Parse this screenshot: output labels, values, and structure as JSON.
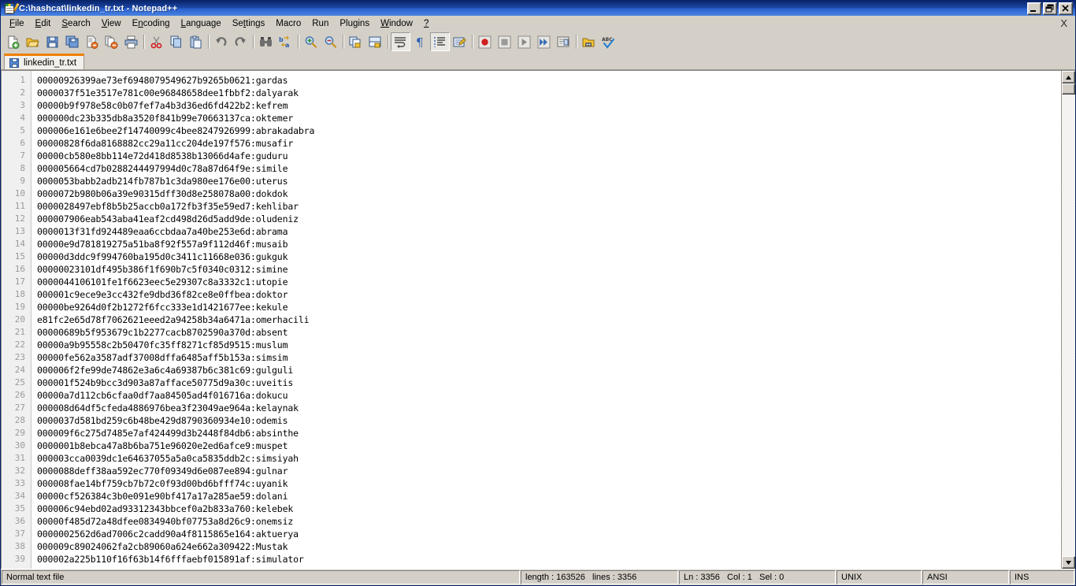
{
  "window": {
    "title": "C:\\hashcat\\linkedin_tr.txt - Notepad++",
    "icon": "notepad-plus-plus-icon",
    "controls": [
      {
        "name": "minimize",
        "glyph": "minimize-icon"
      },
      {
        "name": "restore",
        "glyph": "restore-icon"
      },
      {
        "name": "close",
        "glyph": "close-icon"
      }
    ],
    "colors": {
      "titlebar_start": "#0a246a",
      "titlebar_end": "#4a84e0",
      "chrome": "#d4d0c8",
      "editor_bg": "#ffffff",
      "gutter_bg": "#f0f0f0",
      "gutter_text": "#9a9a9a",
      "tab_accent": "#f08000"
    }
  },
  "menubar": {
    "items": [
      {
        "label": "File",
        "accel": "F"
      },
      {
        "label": "Edit",
        "accel": "E"
      },
      {
        "label": "Search",
        "accel": "S"
      },
      {
        "label": "View",
        "accel": "V"
      },
      {
        "label": "Encoding",
        "accel": "n"
      },
      {
        "label": "Language",
        "accel": "L"
      },
      {
        "label": "Settings",
        "accel": "t"
      },
      {
        "label": "Macro",
        "accel": "M"
      },
      {
        "label": "Run",
        "accel": "R"
      },
      {
        "label": "Plugins",
        "accel": "P"
      },
      {
        "label": "Window",
        "accel": "W"
      },
      {
        "label": "?",
        "accel": "?"
      }
    ],
    "document_close_label": "X"
  },
  "toolbar": {
    "buttons": [
      {
        "name": "new-file-icon",
        "tooltip": "New"
      },
      {
        "name": "open-file-icon",
        "tooltip": "Open"
      },
      {
        "name": "save-icon",
        "tooltip": "Save"
      },
      {
        "name": "save-all-icon",
        "tooltip": "Save All"
      },
      {
        "name": "close-file-icon",
        "tooltip": "Close"
      },
      {
        "name": "close-all-files-icon",
        "tooltip": "Close All"
      },
      {
        "name": "print-icon",
        "tooltip": "Print"
      },
      {
        "sep": true
      },
      {
        "name": "cut-icon",
        "tooltip": "Cut"
      },
      {
        "name": "copy-icon",
        "tooltip": "Copy"
      },
      {
        "name": "paste-icon",
        "tooltip": "Paste"
      },
      {
        "sep": true
      },
      {
        "name": "undo-icon",
        "tooltip": "Undo"
      },
      {
        "name": "redo-icon",
        "tooltip": "Redo"
      },
      {
        "sep": true
      },
      {
        "name": "find-icon",
        "tooltip": "Find"
      },
      {
        "name": "replace-icon",
        "tooltip": "Replace"
      },
      {
        "sep": true
      },
      {
        "name": "zoom-in-icon",
        "tooltip": "Zoom In"
      },
      {
        "name": "zoom-out-icon",
        "tooltip": "Zoom Out"
      },
      {
        "sep": true
      },
      {
        "name": "sync-vertical-scroll-icon",
        "tooltip": "Synchronize Vertical Scrolling"
      },
      {
        "name": "sync-horizontal-scroll-icon",
        "tooltip": "Synchronize Horizontal Scrolling"
      },
      {
        "sep": true
      },
      {
        "name": "word-wrap-icon",
        "tooltip": "Word wrap",
        "pressed": true
      },
      {
        "name": "show-all-characters-icon",
        "tooltip": "Show All Characters"
      },
      {
        "name": "indent-guide-icon",
        "tooltip": "Show Indent Guide",
        "pressed": true
      },
      {
        "name": "user-defined-language-icon",
        "tooltip": "User-Defined Dialogue"
      },
      {
        "sep": true
      },
      {
        "name": "record-macro-icon",
        "tooltip": "Start Recording"
      },
      {
        "name": "stop-macro-icon",
        "tooltip": "Stop Recording"
      },
      {
        "name": "play-macro-icon",
        "tooltip": "Playback"
      },
      {
        "name": "run-macro-multiple-icon",
        "tooltip": "Run a Macro Multiple Times"
      },
      {
        "name": "save-macro-icon",
        "tooltip": "Save Current Recorded Macro"
      },
      {
        "sep": true
      },
      {
        "name": "run-icon",
        "tooltip": "Run"
      },
      {
        "name": "spell-check-icon",
        "tooltip": "Spell Check"
      }
    ]
  },
  "tabs": [
    {
      "label": "linkedin_tr.txt",
      "icon": "saved-file-icon",
      "active": true
    }
  ],
  "editor": {
    "first_line_number": 1,
    "lines": [
      "00000926399ae73ef6948079549627b9265b0621:gardas",
      "0000037f51e3517e781c00e96848658dee1fbbf2:dalyarak",
      "00000b9f978e58c0b07fef7a4b3d36ed6fd422b2:kefrem",
      "000000dc23b335db8a3520f841b99e70663137ca:oktemer",
      "000006e161e6bee2f14740099c4bee8247926999:abrakadabra",
      "00000828f6da8168882cc29a11cc204de197f576:musafir",
      "00000cb580e8bb114e72d418d8538b13066d4afe:guduru",
      "000005664cd7b0288244497994d0c78a87d64f9e:simile",
      "0000053babb2adb214fb787b1c3da980ee176e00:uterus",
      "0000072b980b06a39e90315dff30d8e258078a00:dokdok",
      "0000028497ebf8b5b25accb0a172fb3f35e59ed7:kehlibar",
      "000007906eab543aba41eaf2cd498d26d5add9de:oludeniz",
      "0000013f31fd924489eaa6ccbdaa7a40be253e6d:abrama",
      "00000e9d781819275a51ba8f92f557a9f112d46f:musaib",
      "00000d3ddc9f994760ba195d0c3411c11668e036:gukguk",
      "00000023101df495b386f1f690b7c5f0340c0312:simine",
      "0000044106101fe1f6623eec5e29307c8a3332c1:utopie",
      "000001c9ece9e3cc432fe9dbd36f82ce8e0ffbea:doktor",
      "00000be9264d0f2b1272f6fcc333e1d1421677ee:kekule",
      "e81fc2e65d78f7062621eeed2a94258b34a6471a:omerhacili",
      "00000689b5f953679c1b2277cacb8702590a370d:absent",
      "00000a9b95558c2b50470fc35ff8271cf85d9515:muslum",
      "00000fe562a3587adf37008dffa6485aff5b153a:simsim",
      "000006f2fe99de74862e3a6c4a69387b6c381c69:gulguli",
      "000001f524b9bcc3d903a87afface50775d9a30c:uveitis",
      "00000a7d112cb6cfaa0df7aa84505ad4f016716a:dokucu",
      "000008d64df5cfeda4886976bea3f23049ae964a:kelaynak",
      "0000037d581bd259c6b48be429d8790360934e10:odemis",
      "000009f6c275d7485e7af424499d3b2448f84db6:absinthe",
      "0000001b8ebca47a8b6ba751e96020e2ed6afce9:muspet",
      "000003cca0039dc1e64637055a5a0ca5835ddb2c:simsiyah",
      "0000088deff38aa592ec770f09349d6e087ee894:gulnar",
      "000008fae14bf759cb7b72c0f93d00bd6bfff74c:uyanik",
      "00000cf526384c3b0e091e90bf417a17a285ae59:dolani",
      "000006c94ebd02ad93312343bbcef0a2b833a760:kelebek",
      "00000f485d72a48dfee0834940bf07753a8d26c9:onemsiz",
      "0000002562d6ad7006c2cadd90a4f8115865e164:aktuerya",
      "000009c89024062fa2cb89060a624e662a309422:Mustak",
      "000002a225b110f16f63b14f6fffaebf015891af:simulator"
    ]
  },
  "statusbar": {
    "file_type": "Normal text file",
    "length_lines": "length : 163526   lines : 3356",
    "position": "Ln : 3356   Col : 1   Sel : 0",
    "eol": "UNIX",
    "encoding": "ANSI",
    "insert_mode": "INS"
  }
}
